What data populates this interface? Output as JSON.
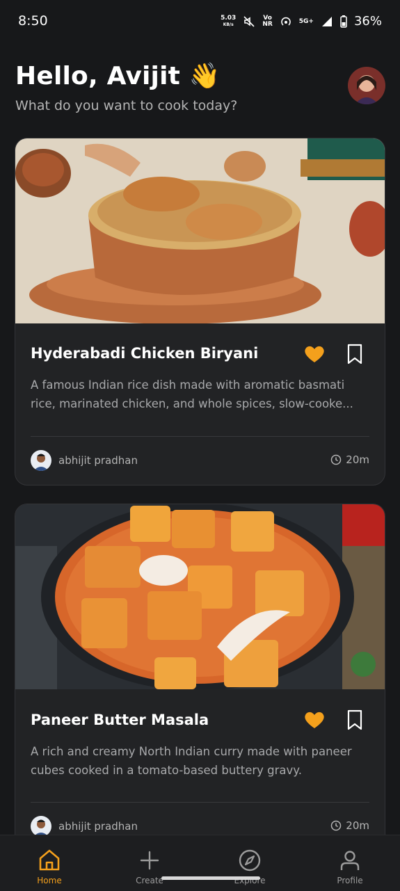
{
  "status_bar": {
    "time": "8:50",
    "net_speed_value": "5.03",
    "net_speed_unit": "KB/s",
    "volte": "Vo",
    "nr": "NR",
    "network": "5G+",
    "battery": "36%"
  },
  "header": {
    "greeting": "Hello, Avijit 👋",
    "subtitle": "What do you want to cook today?"
  },
  "recipes": [
    {
      "title": "Hyderabadi Chicken Biryani",
      "description": "A famous Indian rice dish made with aromatic basmati rice, marinated chicken, and whole spices, slow-cooke...",
      "author": "abhijit pradhan",
      "time": "20m",
      "favorited": true,
      "image": "chicken biryani in copper pot"
    },
    {
      "title": "Paneer Butter Masala",
      "description": "A rich and creamy North Indian curry made with paneer cubes cooked in a tomato-based buttery gravy.",
      "author": "abhijit pradhan",
      "time": "20m",
      "favorited": true,
      "image": "paneer butter masala curry bowl"
    }
  ],
  "nav": {
    "items": [
      {
        "label": "Home",
        "icon": "home-icon",
        "active": true
      },
      {
        "label": "Create",
        "icon": "plus-icon",
        "active": false
      },
      {
        "label": "Explore",
        "icon": "compass-icon",
        "active": false
      },
      {
        "label": "Profile",
        "icon": "user-icon",
        "active": false
      }
    ]
  },
  "colors": {
    "background": "#17181a",
    "card": "#222325",
    "accent": "#f4a01c",
    "text_muted": "#a8a9ab"
  }
}
